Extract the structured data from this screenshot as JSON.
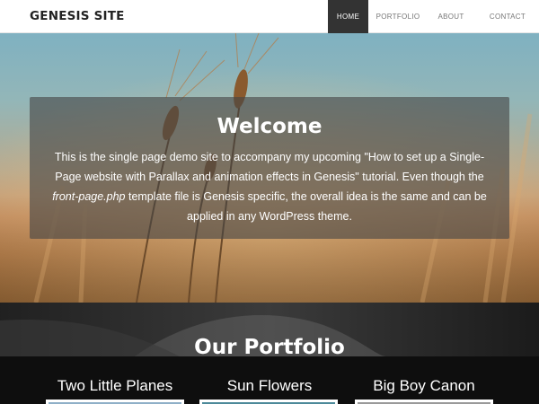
{
  "header": {
    "site_title": "GENESIS SITE",
    "nav": [
      {
        "label": "HOME",
        "active": true
      },
      {
        "label": "PORTFOLIO",
        "active": false
      },
      {
        "label": "ABOUT",
        "active": false
      },
      {
        "label": "CONTACT",
        "active": false
      }
    ]
  },
  "hero": {
    "title": "Welcome",
    "text_part1": "This is the single page demo site to accompany my upcoming \"How to set up a Single-Page website with Parallax and animation effects in Genesis\" tutorial. Even though the ",
    "text_em": "front-page.php",
    "text_part2": " template file is Genesis specific, the overall idea is the same and can be applied in any WordPress theme."
  },
  "portfolio": {
    "title": "Our Portfolio",
    "items": [
      {
        "title": "Two Little Planes"
      },
      {
        "title": "Sun Flowers"
      },
      {
        "title": "Big Boy Canon"
      }
    ]
  },
  "colors": {
    "header_bg": "#ffffff",
    "nav_active_bg": "#333333",
    "overlay": "rgba(70,70,70,0.62)",
    "portfolio_bg": "#151515"
  }
}
